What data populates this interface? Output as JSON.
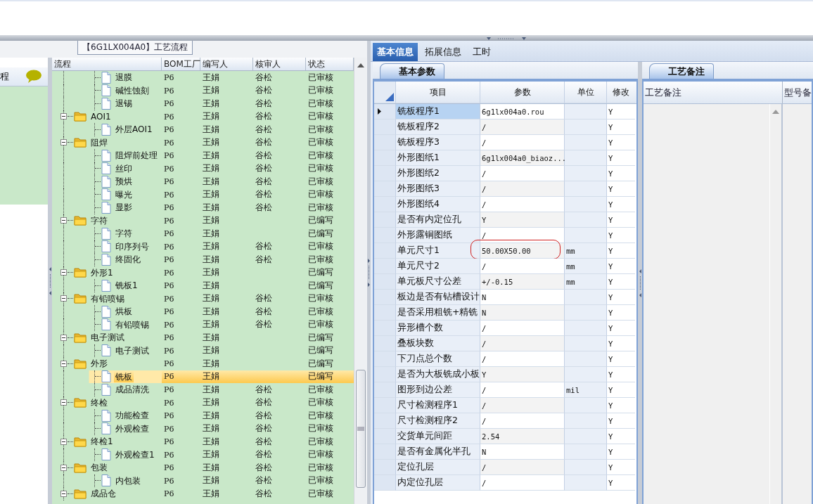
{
  "process_tab": {
    "label": "【6G1LX004A0】工艺流程"
  },
  "side_panel": {
    "title": "程"
  },
  "tree": {
    "columns": [
      "流程",
      "BOM工厂",
      "编写人",
      "核审人",
      "状态"
    ],
    "rows": [
      {
        "kind": "document",
        "label": "退膜",
        "bom": "P6",
        "writer": "王娟",
        "reviewer": "谷松",
        "status": "已审核",
        "selected": false
      },
      {
        "kind": "document",
        "label": "碱性蚀刻",
        "bom": "P6",
        "writer": "王娟",
        "reviewer": "谷松",
        "status": "已审核",
        "selected": false
      },
      {
        "kind": "document",
        "label": "退锡",
        "bom": "P6",
        "writer": "王娟",
        "reviewer": "谷松",
        "status": "已审核",
        "selected": false
      },
      {
        "kind": "folder",
        "label": "AOI1",
        "bom": "P6",
        "writer": "王娟",
        "reviewer": "谷松",
        "status": "已审核",
        "selected": false,
        "expanded": true,
        "children": [
          {
            "kind": "document",
            "label": "外层AOI1",
            "bom": "P6",
            "writer": "王娟",
            "reviewer": "谷松",
            "status": "已审核",
            "selected": false
          }
        ]
      },
      {
        "kind": "folder",
        "label": "阻焊",
        "bom": "P6",
        "writer": "王娟",
        "reviewer": "谷松",
        "status": "已审核",
        "selected": false,
        "expanded": true,
        "children": [
          {
            "kind": "document",
            "label": "阻焊前处理",
            "bom": "P6",
            "writer": "王娟",
            "reviewer": "谷松",
            "status": "已审核",
            "selected": false
          },
          {
            "kind": "document",
            "label": "丝印",
            "bom": "P6",
            "writer": "王娟",
            "reviewer": "谷松",
            "status": "已审核",
            "selected": false
          },
          {
            "kind": "document",
            "label": "预烘",
            "bom": "P6",
            "writer": "王娟",
            "reviewer": "谷松",
            "status": "已审核",
            "selected": false
          },
          {
            "kind": "document",
            "label": "曝光",
            "bom": "P6",
            "writer": "王娟",
            "reviewer": "谷松",
            "status": "已审核",
            "selected": false
          },
          {
            "kind": "document",
            "label": "显影",
            "bom": "P6",
            "writer": "王娟",
            "reviewer": "谷松",
            "status": "已审核",
            "selected": false
          }
        ]
      },
      {
        "kind": "folder",
        "label": "字符",
        "bom": "P6",
        "writer": "王娟",
        "status": "已编写",
        "selected": false,
        "expanded": true,
        "children": [
          {
            "kind": "document",
            "label": "字符",
            "bom": "P6",
            "writer": "王娟",
            "status": "已编写",
            "selected": false
          },
          {
            "kind": "document",
            "label": "印序列号",
            "bom": "P6",
            "writer": "王娟",
            "reviewer": "谷松",
            "status": "已审核",
            "selected": false
          },
          {
            "kind": "document",
            "label": "终固化",
            "bom": "P6",
            "writer": "王娟",
            "reviewer": "谷松",
            "status": "已审核",
            "selected": false
          }
        ]
      },
      {
        "kind": "folder",
        "label": "外形1",
        "bom": "P6",
        "writer": "王娟",
        "status": "已编写",
        "selected": false,
        "expanded": true,
        "children": [
          {
            "kind": "document",
            "label": "铣板1",
            "bom": "P6",
            "writer": "王娟",
            "status": "已编写",
            "selected": false
          }
        ]
      },
      {
        "kind": "folder",
        "label": "有铅喷锡",
        "bom": "P6",
        "writer": "王娟",
        "reviewer": "谷松",
        "status": "已审核",
        "selected": false,
        "expanded": true,
        "children": [
          {
            "kind": "document",
            "label": "烘板",
            "bom": "P6",
            "writer": "王娟",
            "reviewer": "谷松",
            "status": "已审核",
            "selected": false
          },
          {
            "kind": "document",
            "label": "有铅喷锡",
            "bom": "P6",
            "writer": "王娟",
            "reviewer": "谷松",
            "status": "已审核",
            "selected": false
          }
        ]
      },
      {
        "kind": "folder",
        "label": "电子测试",
        "bom": "P6",
        "writer": "王娟",
        "status": "已编写",
        "selected": false,
        "expanded": true,
        "children": [
          {
            "kind": "document",
            "label": "电子测试",
            "bom": "P6",
            "writer": "王娟",
            "status": "已编写",
            "selected": false
          }
        ]
      },
      {
        "kind": "folder",
        "label": "外形",
        "bom": "P6",
        "writer": "王娟",
        "status": "已编写",
        "selected": false,
        "expanded": true,
        "children": [
          {
            "kind": "document",
            "label": "铣板",
            "bom": "P6",
            "writer": "王娟",
            "status": "已编写",
            "selected": true
          },
          {
            "kind": "document",
            "label": "成品清洗",
            "bom": "P6",
            "writer": "王娟",
            "reviewer": "谷松",
            "status": "已审核",
            "selected": false
          }
        ]
      },
      {
        "kind": "folder",
        "label": "终检",
        "bom": "P6",
        "writer": "王娟",
        "reviewer": "谷松",
        "status": "已审核",
        "selected": false,
        "expanded": true,
        "children": [
          {
            "kind": "document",
            "label": "功能检查",
            "bom": "P6",
            "writer": "王娟",
            "reviewer": "谷松",
            "status": "已审核",
            "selected": false
          },
          {
            "kind": "document",
            "label": "外观检查",
            "bom": "P6",
            "writer": "王娟",
            "reviewer": "谷松",
            "status": "已审核",
            "selected": false
          }
        ]
      },
      {
        "kind": "folder",
        "label": "终检1",
        "bom": "P6",
        "writer": "王娟",
        "reviewer": "谷松",
        "status": "已审核",
        "selected": false,
        "expanded": true,
        "children": [
          {
            "kind": "document",
            "label": "外观检查1",
            "bom": "P6",
            "writer": "王娟",
            "reviewer": "谷松",
            "status": "已审核",
            "selected": false
          }
        ]
      },
      {
        "kind": "folder",
        "label": "包装",
        "bom": "P6",
        "writer": "王娟",
        "reviewer": "谷松",
        "status": "已审核",
        "selected": false,
        "expanded": true,
        "children": [
          {
            "kind": "document",
            "label": "内包装",
            "bom": "P6",
            "writer": "王娟",
            "reviewer": "谷松",
            "status": "已审核",
            "selected": false
          }
        ]
      },
      {
        "kind": "folder",
        "label": "成品仓",
        "bom": "P6",
        "writer": "王娟",
        "reviewer": "谷松",
        "status": "已审核",
        "selected": false,
        "expanded": true
      }
    ]
  },
  "tabs": [
    {
      "label": "基本信息",
      "selected": true
    },
    {
      "label": "拓展信息",
      "selected": false
    },
    {
      "label": "工时",
      "selected": false
    }
  ],
  "params": {
    "tab": "基本参数",
    "columns": [
      "项目",
      "参数",
      "单位",
      "修改"
    ],
    "rows": [
      {
        "item": "铣板程序1",
        "value": "6g1lx004a0.rou",
        "modified": "Y",
        "selected": true,
        "circled": false
      },
      {
        "item": "铣板程序2",
        "value": "/",
        "modified": "Y",
        "selected": false,
        "circled": false
      },
      {
        "item": "铣板程序3",
        "value": "/",
        "modified": "Y",
        "selected": false,
        "circled": false
      },
      {
        "item": "外形图纸1",
        "value": "6g1lx004a0_biaoz...",
        "modified": "Y",
        "selected": false,
        "circled": false
      },
      {
        "item": "外形图纸2",
        "value": "/",
        "modified": "Y",
        "selected": false,
        "circled": false
      },
      {
        "item": "外形图纸3",
        "value": "/",
        "modified": "Y",
        "selected": false,
        "circled": false
      },
      {
        "item": "外形图纸4",
        "value": "/",
        "modified": "Y",
        "selected": false,
        "circled": false
      },
      {
        "item": "是否有内定位孔",
        "value": "Y",
        "modified": "Y",
        "selected": false,
        "circled": false
      },
      {
        "item": "外形露铜图纸",
        "value": "/",
        "modified": "Y",
        "selected": false,
        "circled": false
      },
      {
        "item": "单元尺寸1",
        "value": "50.00X50.00",
        "unit": "mm",
        "modified": "Y",
        "selected": false,
        "circled": true
      },
      {
        "item": "单元尺寸2",
        "value": "/",
        "unit": "mm",
        "modified": "Y",
        "selected": false,
        "circled": false
      },
      {
        "item": "单元板尺寸公差",
        "value": "+/-0.15",
        "unit": "mm",
        "modified": "Y",
        "selected": false,
        "circled": false
      },
      {
        "item": "板边是否有钻槽设计",
        "value": "N",
        "modified": "Y",
        "selected": false,
        "circled": false
      },
      {
        "item": "是否采用粗铣+精铣",
        "value": "N",
        "modified": "Y",
        "selected": false,
        "circled": false
      },
      {
        "item": "异形槽个数",
        "value": "/",
        "modified": "Y",
        "selected": false,
        "circled": false
      },
      {
        "item": "叠板块数",
        "value": "/",
        "modified": "Y",
        "selected": false,
        "circled": false
      },
      {
        "item": "下刀点总个数",
        "value": "/",
        "modified": "Y",
        "selected": false,
        "circled": false
      },
      {
        "item": "是否为大板铣成小板",
        "value": "Y",
        "modified": "Y",
        "selected": false,
        "circled": false
      },
      {
        "item": "图形到边公差",
        "value": "/",
        "unit": "mil",
        "modified": "Y",
        "selected": false,
        "circled": false
      },
      {
        "item": "尺寸检测程序1",
        "value": "/",
        "modified": "Y",
        "selected": false,
        "circled": false
      },
      {
        "item": "尺寸检测程序2",
        "value": "/",
        "modified": "Y",
        "selected": false,
        "circled": false
      },
      {
        "item": "交货单元间距",
        "value": "2.54",
        "modified": "Y",
        "selected": false,
        "circled": false
      },
      {
        "item": "是否有金属化半孔",
        "value": "N",
        "modified": "Y",
        "selected": false,
        "circled": false
      },
      {
        "item": "定位孔层",
        "value": "/",
        "modified": "Y",
        "selected": false,
        "circled": false
      },
      {
        "item": "内定位孔层",
        "value": "/",
        "modified": "Y",
        "selected": false,
        "circled": false
      }
    ]
  },
  "notes": {
    "tab": "工艺备注",
    "columns": [
      "工艺备注",
      "型号备"
    ]
  }
}
